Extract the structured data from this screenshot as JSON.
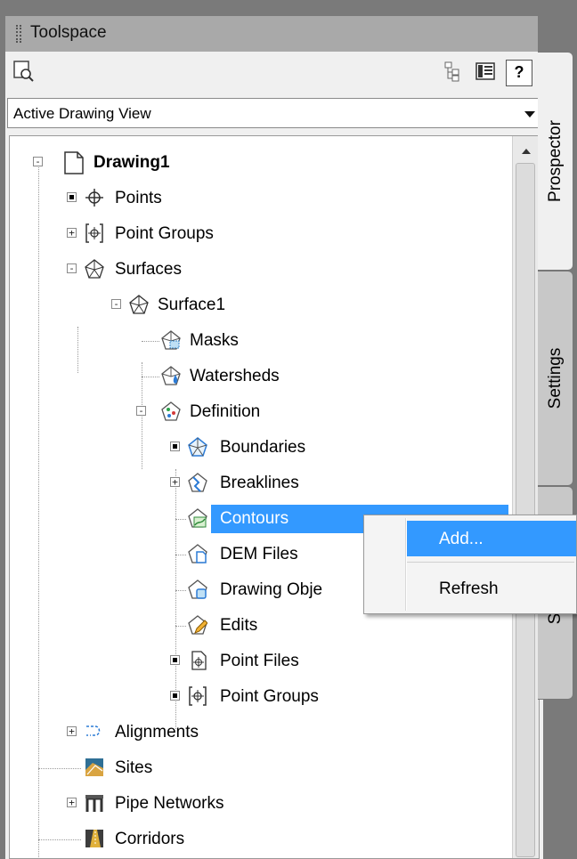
{
  "window": {
    "title": "Toolspace"
  },
  "toolbar": {
    "icons": [
      "search-icon",
      "tree-view-icon",
      "item-view-icon",
      "help-icon"
    ],
    "help_label": "?"
  },
  "view_selector": {
    "value": "Active Drawing View"
  },
  "tree": {
    "root": "Drawing1",
    "items": {
      "points": "Points",
      "point_groups": "Point Groups",
      "surfaces": "Surfaces",
      "surface1": "Surface1",
      "masks": "Masks",
      "watersheds": "Watersheds",
      "definition": "Definition",
      "boundaries": "Boundaries",
      "breaklines": "Breaklines",
      "contours": "Contours",
      "dem_files": "DEM Files",
      "drawing_objects": "Drawing Obje",
      "edits": "Edits",
      "point_files": "Point Files",
      "point_groups_def": "Point Groups",
      "alignments": "Alignments",
      "sites": "Sites",
      "pipe_networks": "Pipe Networks",
      "corridors": "Corridors"
    },
    "selected": "Contours"
  },
  "tabs": {
    "prospector": "Prospector",
    "settings": "Settings",
    "survey_partial": "S"
  },
  "context_menu": {
    "add": "Add...",
    "refresh": "Refresh"
  },
  "colors": {
    "selection": "#3399ff",
    "panel": "#f0f0f0",
    "titlebar": "#a9a9a9",
    "frame": "#7a7a7a"
  }
}
